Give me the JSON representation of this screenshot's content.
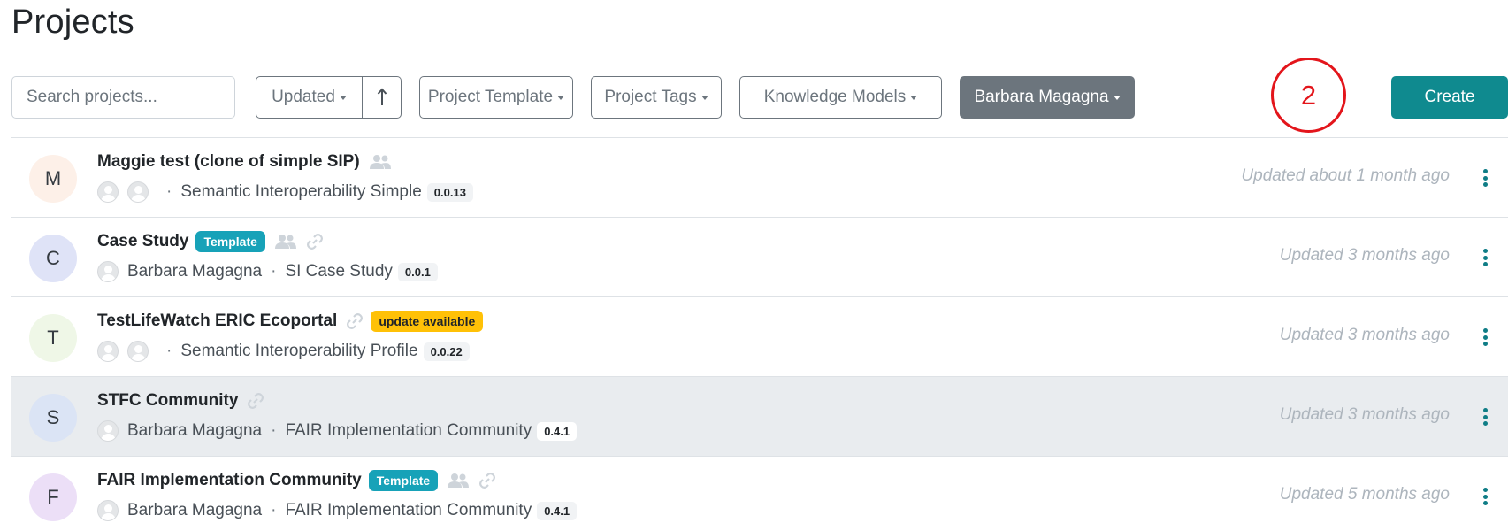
{
  "page": {
    "title": "Projects"
  },
  "toolbar": {
    "search_placeholder": "Search projects...",
    "sort_label": "Updated",
    "sort_direction_icon": "arrow-up-icon",
    "filters": [
      {
        "label": "Project Template"
      },
      {
        "label": "Project Tags"
      },
      {
        "label": "Knowledge Models"
      }
    ],
    "user_filter_label": "Barbara Magagna",
    "create_label": "Create"
  },
  "annotation": {
    "label": "2",
    "color": "#e3151b"
  },
  "colors": {
    "primary": "#0f8a8f",
    "template_badge": "#17a2b8",
    "update_badge": "#ffc107",
    "active_filter": "#6c757d"
  },
  "projects": [
    {
      "initial": "M",
      "avatar_color": "#fdf0e8",
      "name": "Maggie test (clone of simple SIP)",
      "badges": [],
      "icons": [
        "users-icon"
      ],
      "owner": "",
      "show_two_avatars": true,
      "knowledge_model": "Semantic Interoperability Simple",
      "version": "0.0.13",
      "updated": "Updated about 1 month ago"
    },
    {
      "initial": "C",
      "avatar_color": "#dfe3f7",
      "name": "Case Study",
      "badges": [
        "Template"
      ],
      "icons": [
        "users-icon",
        "link-icon"
      ],
      "owner": "Barbara Magagna",
      "knowledge_model": "SI Case Study",
      "version": "0.0.1",
      "updated": "Updated 3 months ago"
    },
    {
      "initial": "T",
      "avatar_color": "#eff7e7",
      "name": "TestLifeWatch ERIC Ecoportal",
      "badges": [
        "update available"
      ],
      "icons": [
        "link-icon"
      ],
      "owner": "",
      "show_two_avatars": true,
      "knowledge_model": "Semantic Interoperability Profile",
      "version": "0.0.22",
      "updated": "Updated 3 months ago"
    },
    {
      "initial": "S",
      "avatar_color": "#dbe4f5",
      "name": "STFC Community",
      "badges": [],
      "icons": [
        "link-icon"
      ],
      "owner": "Barbara Magagna",
      "knowledge_model": "FAIR Implementation Community",
      "version": "0.4.1",
      "updated": "Updated 3 months ago"
    },
    {
      "initial": "F",
      "avatar_color": "#ecdff7",
      "name": "FAIR Implementation Community",
      "badges": [
        "Template"
      ],
      "icons": [
        "users-icon",
        "link-icon"
      ],
      "owner": "Barbara Magagna",
      "knowledge_model": "FAIR Implementation Community",
      "version": "0.4.1",
      "updated": "Updated 5 months ago"
    }
  ]
}
